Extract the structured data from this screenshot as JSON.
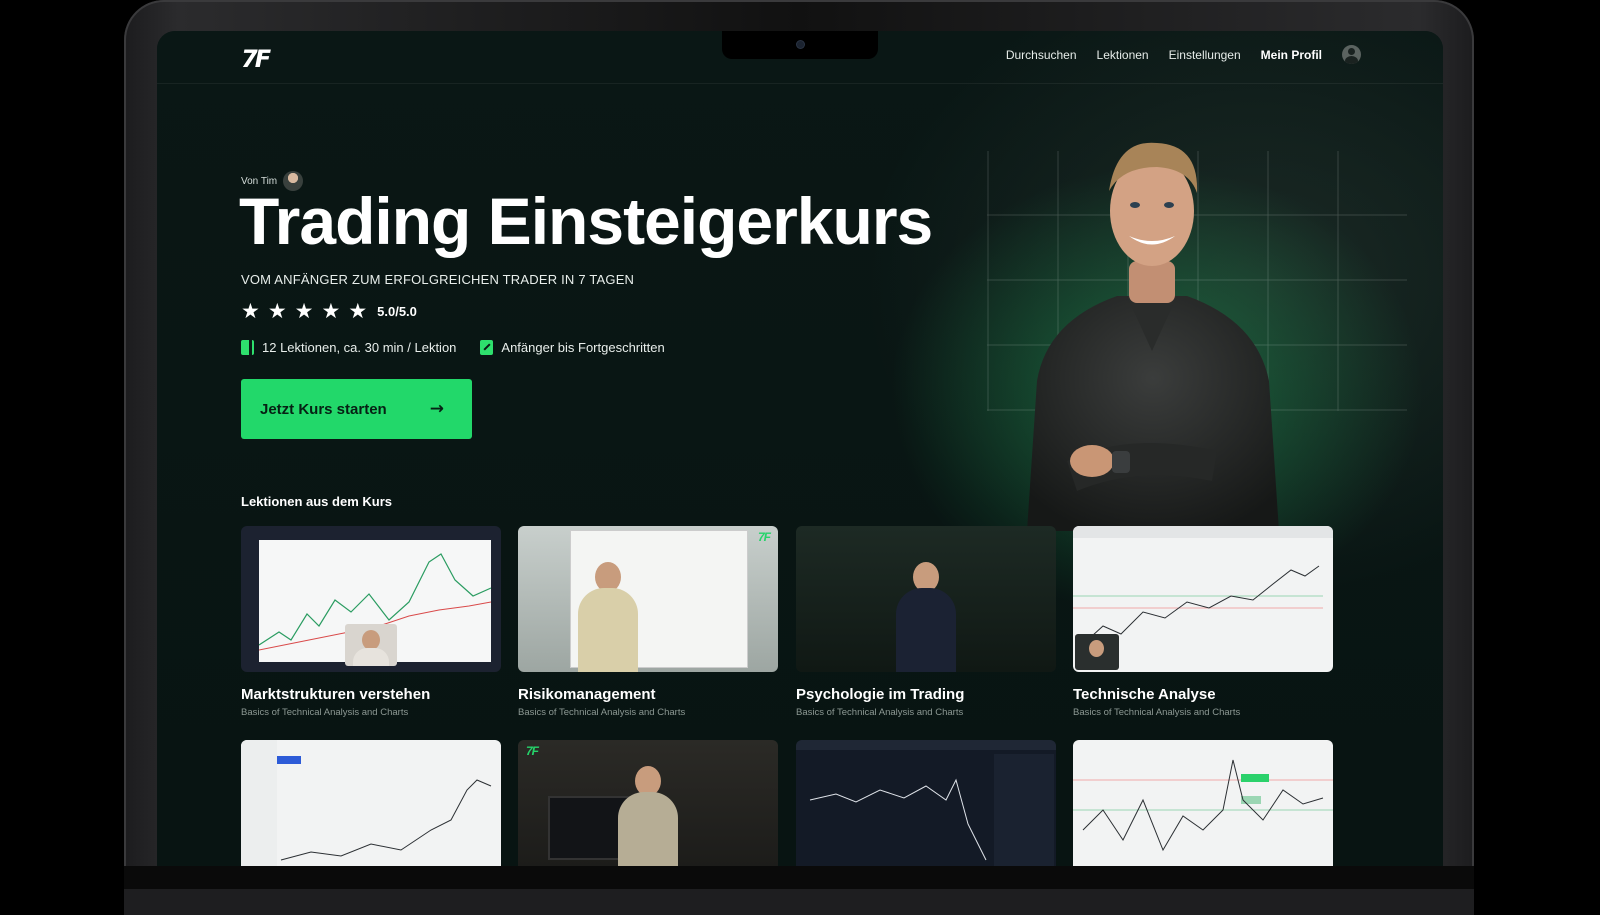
{
  "nav": {
    "logo": "7F",
    "links": [
      "Durchsuchen",
      "Lektionen",
      "Einstellungen"
    ],
    "profile": "Mein Profil"
  },
  "hero": {
    "author": "Von Tim",
    "title": "Trading Einsteigerkurs",
    "subtitle": "VOM ANFÄNGER ZUM ERFOLGREICHEN TRADER IN 7 TAGEN",
    "stars": 5,
    "rating": "5.0/5.0",
    "meta": [
      {
        "icon": "book-icon",
        "text": "12 Lektionen, ca. 30 min / Lektion"
      },
      {
        "icon": "pencil-icon",
        "text": "Anfänger bis Fortgeschritten"
      }
    ],
    "cta": "Jetzt Kurs starten",
    "cta_icon": "arrow-right-icon"
  },
  "lessons": {
    "title": "Lektionen aus dem Kurs",
    "items": [
      {
        "title": "Marktstrukturen verstehen",
        "subtitle": "Basics of Technical Analysis and Charts"
      },
      {
        "title": "Risikomanagement",
        "subtitle": "Basics of Technical Analysis and Charts"
      },
      {
        "title": "Psychologie im Trading",
        "subtitle": "Basics of Technical Analysis and Charts"
      },
      {
        "title": "Technische Analyse",
        "subtitle": "Basics of Technical Analysis and Charts"
      }
    ]
  },
  "colors": {
    "accent": "#22d86a",
    "background": "#071513"
  }
}
